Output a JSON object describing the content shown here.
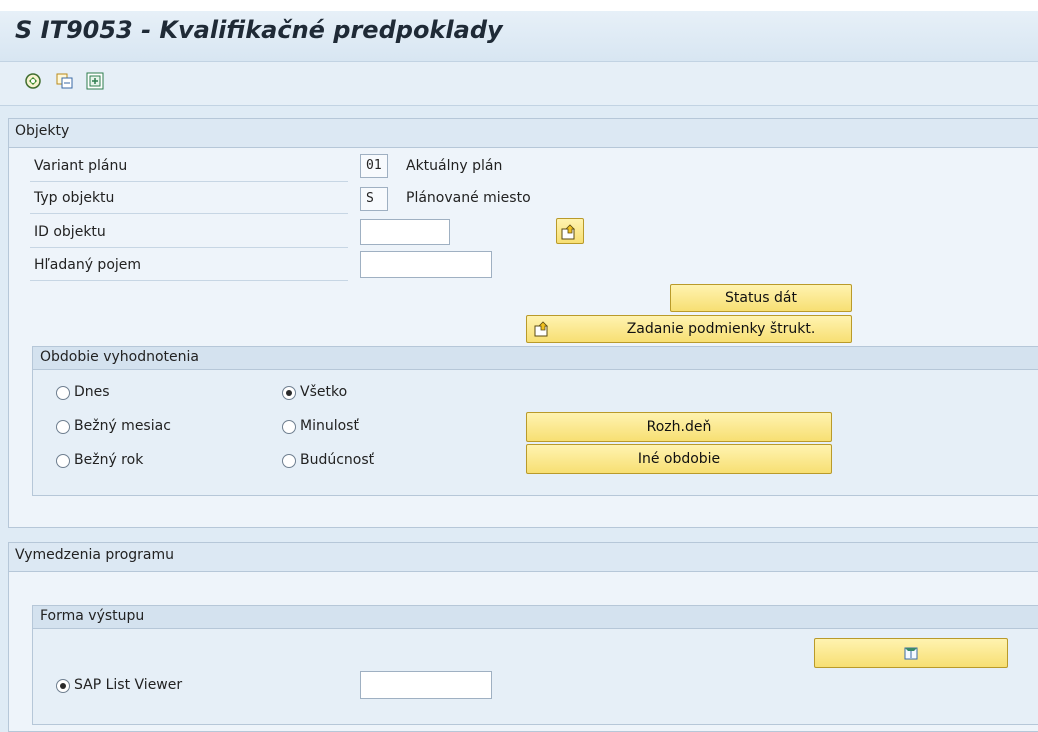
{
  "window": {
    "title": "S IT9053 - Kvalifikačné predpoklady"
  },
  "toolbar": {
    "icons": [
      "execute-icon",
      "copy-variant-icon",
      "save-variant-icon"
    ]
  },
  "objects": {
    "header": "Objekty",
    "plan_variant": {
      "label": "Variant plánu",
      "value": "01",
      "text": "Aktuálny plán"
    },
    "object_type": {
      "label": "Typ objektu",
      "value": "S",
      "text": "Plánované miesto"
    },
    "object_id": {
      "label": "ID objektu",
      "value": ""
    },
    "search_term": {
      "label": "Hľadaný pojem",
      "value": ""
    },
    "status_button": "Status dát",
    "structure_button": "Zadanie podmienky štrukt."
  },
  "period": {
    "header": "Obdobie vyhodnotenia",
    "options": {
      "today": "Dnes",
      "all": "Všetko",
      "current_month": "Bežný mesiac",
      "past": "Minulosť",
      "current_year": "Bežný rok",
      "future": "Budúcnosť"
    },
    "selected": "Všetko",
    "key_date_button": "Rozh.deň",
    "other_period_button": "Iné obdobie"
  },
  "program": {
    "header": "Vymedzenia programu",
    "output": {
      "header": "Forma výstupu",
      "alv_option": "SAP List Viewer",
      "alv_selected": true,
      "layout_value": ""
    }
  }
}
